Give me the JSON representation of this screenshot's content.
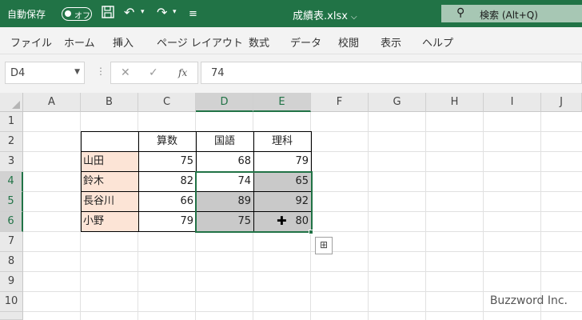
{
  "titlebar": {
    "autosave_label": "自動保存",
    "autosave_state": "オフ",
    "filename": "成績表.xlsx",
    "search_label": "検索 (Alt+Q)"
  },
  "menu": [
    "ファイル",
    "ホーム",
    "挿入",
    "ページ レイアウト",
    "数式",
    "データ",
    "校閲",
    "表示",
    "ヘルプ"
  ],
  "formula_bar": {
    "name_box": "D4",
    "fx_label": "fx",
    "value": "74"
  },
  "columns": [
    "A",
    "B",
    "C",
    "D",
    "E",
    "F",
    "G",
    "H",
    "I",
    "J"
  ],
  "rows": [
    "1",
    "2",
    "3",
    "4",
    "5",
    "6",
    "7",
    "8",
    "9",
    "10"
  ],
  "table": {
    "headers": [
      "算数",
      "国語",
      "理科"
    ],
    "rows": [
      {
        "name": "山田",
        "values": [
          "75",
          "68",
          "79"
        ]
      },
      {
        "name": "鈴木",
        "values": [
          "82",
          "74",
          "65"
        ]
      },
      {
        "name": "長谷川",
        "values": [
          "66",
          "89",
          "92"
        ]
      },
      {
        "name": "小野",
        "values": [
          "79",
          "75",
          "80"
        ]
      }
    ]
  },
  "colors": {
    "accent": "#217346",
    "name_fill": "#fce4d6",
    "selected_fill": "#c9c9c9"
  },
  "watermark": "Buzzword Inc."
}
